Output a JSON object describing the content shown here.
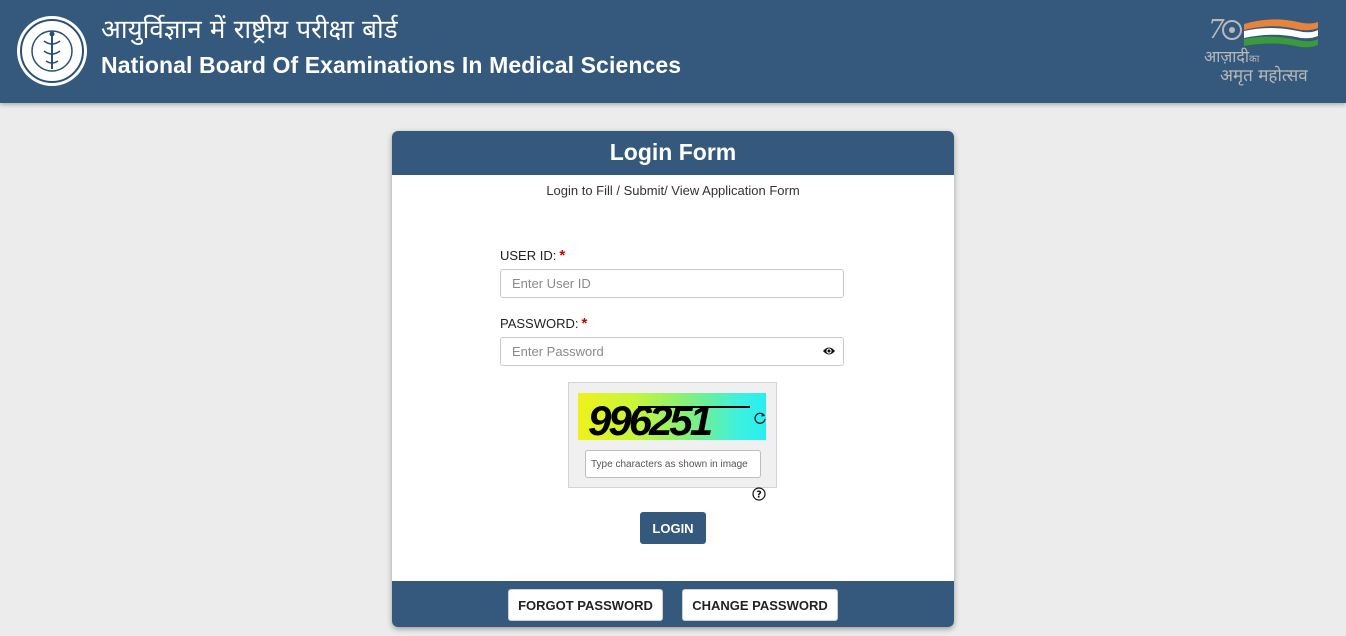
{
  "header": {
    "title_hindi": "आयुर्विज्ञान में राष्ट्रीय परीक्षा बोर्ड",
    "title_english": "National Board Of Examinations In Medical Sciences",
    "logo_icon": "nbems-seal-icon",
    "azadi_logo": {
      "line1": "आज़ादी",
      "line1_small": "का",
      "line2": "अमृत महोत्सव",
      "number": "75"
    }
  },
  "login_form": {
    "title": "Login Form",
    "subtitle": "Login to Fill / Submit/ View Application Form",
    "user_id": {
      "label": "USER ID:",
      "required_mark": "*",
      "placeholder": "Enter User ID",
      "value": ""
    },
    "password": {
      "label": "PASSWORD:",
      "required_mark": "*",
      "placeholder": "Enter Password",
      "value": "",
      "toggle_icon": "eye-icon"
    },
    "captcha": {
      "code": "996251",
      "placeholder": "Type characters as shown in image",
      "value": "",
      "refresh_icon": "refresh-icon",
      "help_icon": "question-circle-icon"
    },
    "login_button": "LOGIN",
    "forgot_password_button": "FORGOT PASSWORD",
    "change_password_button": "CHANGE PASSWORD"
  },
  "colors": {
    "header_bg": "#34597d",
    "page_bg": "#ececec",
    "required": "#cc0000"
  }
}
